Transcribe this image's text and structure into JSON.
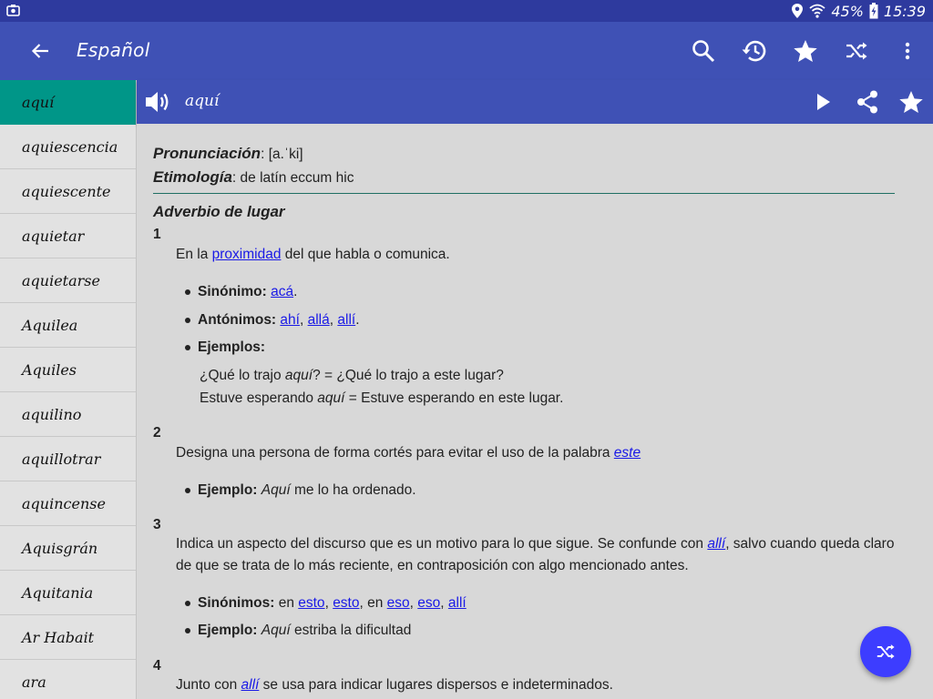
{
  "status": {
    "battery": "45%",
    "time": "15:39"
  },
  "appbar": {
    "title": "Español"
  },
  "sidebar": {
    "items": [
      {
        "label": "aquí"
      },
      {
        "label": "aquiescencia"
      },
      {
        "label": "aquiescente"
      },
      {
        "label": "aquietar"
      },
      {
        "label": "aquietarse"
      },
      {
        "label": "Aquilea"
      },
      {
        "label": "Aquiles"
      },
      {
        "label": "aquilino"
      },
      {
        "label": "aquillotrar"
      },
      {
        "label": "aquincense"
      },
      {
        "label": "Aquisgrán"
      },
      {
        "label": "Aquitania"
      },
      {
        "label": "Ar Habait"
      },
      {
        "label": "ara"
      }
    ]
  },
  "wordbar": {
    "word": "aquí"
  },
  "entry": {
    "pron_label": "Pronunciación",
    "pron_value": ": [a.ˈki]",
    "etym_label": "Etimología",
    "etym_value": ": de latín eccum hic",
    "pos": "Adverbio de lugar",
    "s1": {
      "num": "1",
      "def_a": "En la ",
      "def_link": "proximidad",
      "def_b": " del que habla o comunica.",
      "syn_label": "Sinónimo:",
      "syn_link": "acá",
      "syn_end": ".",
      "ant_label": "Antónimos:",
      "ant_1": "ahí",
      "ant_2": "allá",
      "ant_3": "allí",
      "ant_sep": ", ",
      "ant_end": ".",
      "ej_label": "Ejemplos:",
      "ex1_a": "¿Qué lo trajo ",
      "ex1_i": "aquí",
      "ex1_b": "? = ¿Qué lo trajo a este lugar?",
      "ex2_a": "Estuve esperando ",
      "ex2_i": "aquí",
      "ex2_b": " = Estuve esperando en este lugar."
    },
    "s2": {
      "num": "2",
      "def_a": "Designa una persona de forma cortés para evitar el uso de la palabra ",
      "def_link": "este",
      "ej_label": "Ejemplo:",
      "ej_i": "Aquí",
      "ej_b": " me lo ha ordenado."
    },
    "s3": {
      "num": "3",
      "def_a": "Indica un aspecto del discurso que es un motivo para lo que sigue. Se confunde con ",
      "def_link": "allí",
      "def_b": ", salvo cuando queda claro de que se trata de lo más reciente, en contraposición con algo mencionado antes.",
      "syn_label": "Sinónimos:",
      "syn_en1": " en ",
      "syn_1": "esto",
      "syn_sep": ", ",
      "syn_2": "esto",
      "syn_en2": ", en ",
      "syn_3": "eso",
      "syn_4": "eso",
      "syn_5": "allí",
      "ej_label": "Ejemplo:",
      "ej_i": "Aquí",
      "ej_b": " estriba la dificultad"
    },
    "s4": {
      "num": "4",
      "def_a": "Junto con ",
      "def_link": "allí",
      "def_b": " se usa para indicar lugares dispersos e indeterminados."
    }
  },
  "colors": {
    "primary": "#3f51b5",
    "statusbar": "#2e3a9e",
    "accent": "#009688",
    "fab": "#3d3dff"
  }
}
